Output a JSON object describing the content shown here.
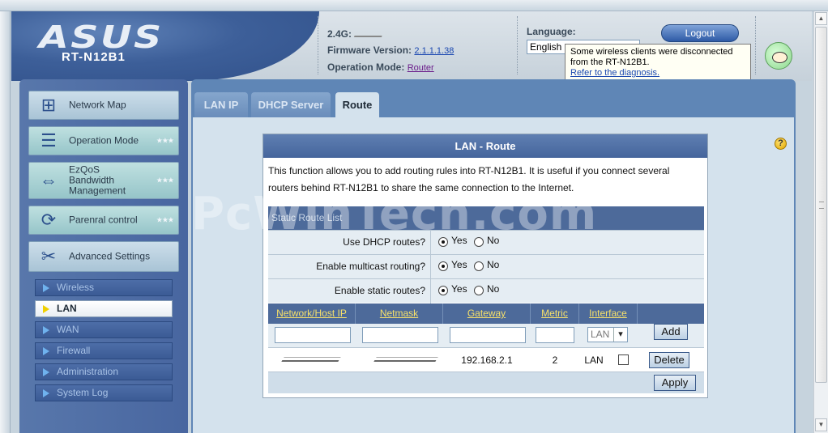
{
  "header": {
    "brand": "ASUS",
    "model": "RT-N12B1",
    "band_label": "2.4G:",
    "firmware_label": "Firmware Version:",
    "firmware_version": "2.1.1.1.38",
    "mode_label": "Operation Mode:",
    "mode_value": "Router",
    "language_label": "Language:",
    "language_value": "English",
    "logout_label": "Logout",
    "tooltip_text": "Some wireless clients were disconnected from the RT-N12B1.",
    "tooltip_link": "Refer to the diagnosis."
  },
  "sidebar": {
    "items": [
      {
        "label": "Network Map"
      },
      {
        "label": "Operation Mode"
      },
      {
        "label": "EzQoS\nBandwidth\nManagement"
      },
      {
        "label": "Parenral control"
      },
      {
        "label": "Advanced Settings"
      }
    ],
    "subitems": [
      {
        "label": "Wireless"
      },
      {
        "label": "LAN"
      },
      {
        "label": "WAN"
      },
      {
        "label": "Firewall"
      },
      {
        "label": "Administration"
      },
      {
        "label": "System Log"
      }
    ]
  },
  "tabs": [
    {
      "label": "LAN IP"
    },
    {
      "label": "DHCP Server"
    },
    {
      "label": "Route"
    }
  ],
  "panel": {
    "title": "LAN - Route",
    "description": "This function allows you to add routing rules into RT-N12B1. It is useful if you connect several routers behind RT-N12B1 to share the same connection to the Internet.",
    "section_title": "Static Route List",
    "options": [
      {
        "label": "Use DHCP routes?",
        "yes": "Yes",
        "no": "No",
        "selected": "yes"
      },
      {
        "label": "Enable multicast routing?",
        "yes": "Yes",
        "no": "No",
        "selected": "yes"
      },
      {
        "label": "Enable static routes?",
        "yes": "Yes",
        "no": "No",
        "selected": "yes"
      }
    ],
    "columns": [
      "Network/Host IP",
      "Netmask",
      "Gateway",
      "Metric",
      "Interface"
    ],
    "input_row": {
      "interface_value": "LAN",
      "add_label": "Add"
    },
    "routes": [
      {
        "gateway": "192.168.2.1",
        "metric": "2",
        "interface": "LAN",
        "delete_label": "Delete"
      }
    ],
    "apply_label": "Apply"
  },
  "watermark": "PcWinTech.com"
}
